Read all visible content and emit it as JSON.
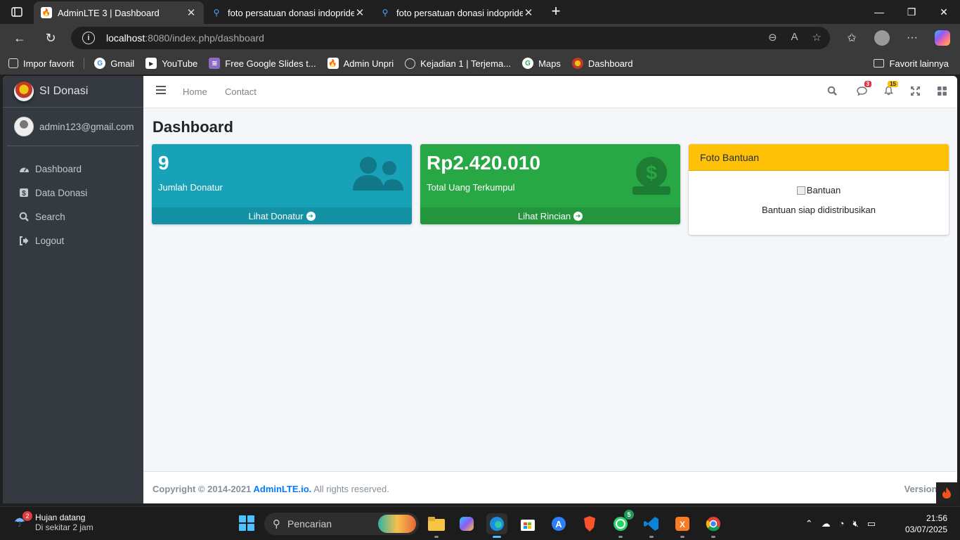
{
  "browser": {
    "tabs": [
      {
        "title": "AdminLTE 3 | Dashboard",
        "active": true,
        "favicon": "flame-icon"
      },
      {
        "title": "foto persatuan donasi indopride -",
        "active": false,
        "favicon": "search-icon"
      },
      {
        "title": "foto persatuan donasi indopride -",
        "active": false,
        "favicon": "search-icon"
      }
    ],
    "url_host": "localhost",
    "url_rest": ":8080/index.php/dashboard",
    "bookmarks": [
      {
        "label": "Impor favorit",
        "icon": "import-icon"
      },
      {
        "label": "Gmail",
        "icon": "google-icon"
      },
      {
        "label": "YouTube",
        "icon": "youtube-icon"
      },
      {
        "label": "Free Google Slides t...",
        "icon": "slides-icon"
      },
      {
        "label": "Admin Unpri",
        "icon": "flame-icon"
      },
      {
        "label": "Kejadian 1 | Terjema...",
        "icon": "globe-icon"
      },
      {
        "label": "Maps",
        "icon": "google-icon"
      },
      {
        "label": "Dashboard",
        "icon": "dashboard-icon"
      }
    ],
    "bookmarks_other": "Favorit lainnya"
  },
  "sidebar": {
    "brand": "SI Donasi",
    "user": "admin123@gmail.com",
    "items": [
      {
        "label": "Dashboard",
        "icon": "tachometer-icon"
      },
      {
        "label": "Data Donasi",
        "icon": "money-bill-icon"
      },
      {
        "label": "Search",
        "icon": "search-icon"
      },
      {
        "label": "Logout",
        "icon": "sign-out-icon"
      }
    ]
  },
  "header": {
    "nav": [
      "Home",
      "Contact"
    ],
    "messages_badge": "3",
    "notifications_badge": "15"
  },
  "main": {
    "title": "Dashboard",
    "boxes": [
      {
        "value": "9",
        "label": "Jumlah Donatur",
        "link": "Lihat Donatur",
        "color": "#17a2b8",
        "icon": "users-icon"
      },
      {
        "value": "Rp2.420.010",
        "label": "Total Uang Terkumpul",
        "link": "Lihat Rincian",
        "color": "#28a745",
        "icon": "donate-icon"
      }
    ],
    "card": {
      "title": "Foto Bantuan",
      "img_alt": "Bantuan",
      "caption": "Bantuan siap didistribusikan",
      "header_color": "#ffc107"
    }
  },
  "footer": {
    "copyright": "Copyright © 2014-2021 ",
    "link": "AdminLTE.io.",
    "rights": " All rights reserved.",
    "version": "Version 3."
  },
  "taskbar": {
    "weather_title": "Hujan datang",
    "weather_sub": "Di sekitar 2 jam",
    "weather_badge": "2",
    "search_placeholder": "Pencarian",
    "whatsapp_badge": "5",
    "time": "21:56",
    "date": "03/07/2025"
  }
}
